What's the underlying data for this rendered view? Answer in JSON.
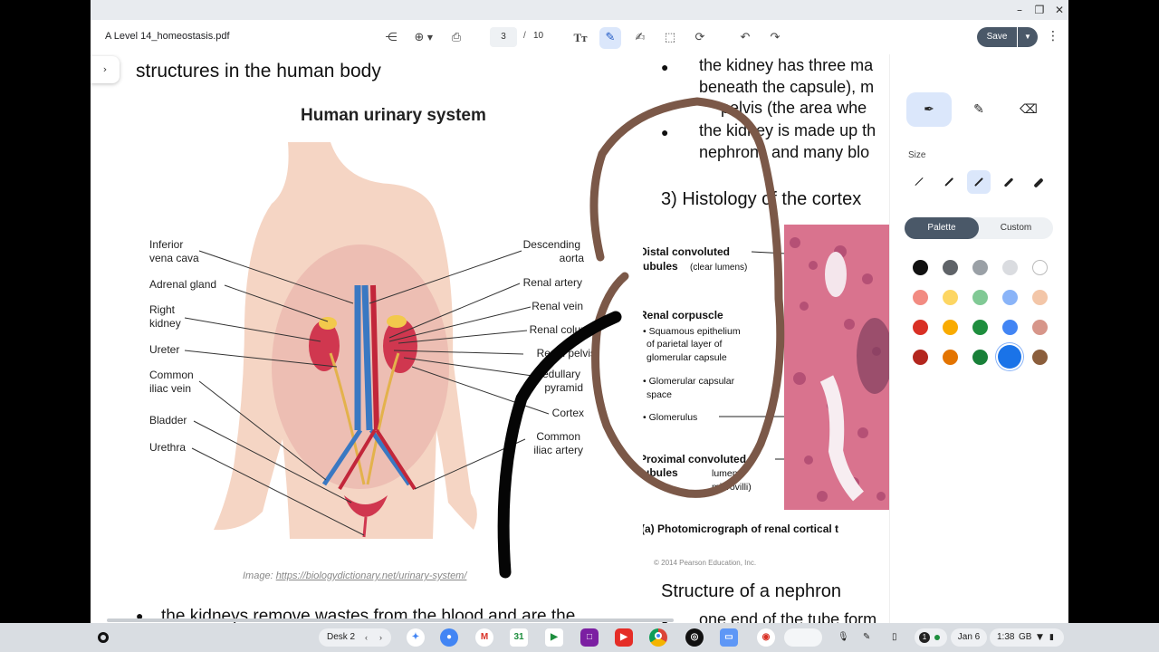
{
  "window": {
    "doc_title": "A Level 14_homeostasis.pdf",
    "current_page": "3",
    "page_separator": "/",
    "total_pages": "10",
    "save_label": "Save"
  },
  "document": {
    "left_heading": "structures in the human body",
    "diagram_title": "Human urinary system",
    "left_labels": [
      "Inferior",
      "vena cava",
      "Adrenal gland",
      "Right",
      "kidney",
      "Ureter",
      "Common",
      "iliac vein",
      "Bladder",
      "Urethra"
    ],
    "right_labels": [
      "Descending",
      "aorta",
      "Renal artery",
      "Renal vein",
      "Renal column",
      "Renal pelvis",
      "Medullary",
      "pyramid",
      "Cortex",
      "Common",
      "iliac artery"
    ],
    "image_credit_prefix": "Image: ",
    "image_credit_link": "https://biologydictionary.net/urinary-system/",
    "left_bullet": "the kidneys remove wastes from the blood and are the",
    "right_lines": [
      "the kidney has three ma",
      "beneath the capsule), m",
      "pelvis (the area whe",
      "the kidney is made up th",
      "nephrons and many blo"
    ],
    "histology_title": "3) Histology of the cortex",
    "histology_labels": {
      "dct": "Distal convoluted",
      "dct2": "tubules",
      "dct3": "(clear lumens)",
      "rc": "Renal corpuscle",
      "sq1": "• Squamous epithelium",
      "sq2": "of parietal layer of",
      "sq3": "glomerular capsule",
      "gcs1": "• Glomerular capsular",
      "gcs2": "space",
      "glom": "• Glomerulus",
      "pct1": "Proximal convoluted",
      "pct2": "tubules",
      "pct3": "lumens",
      "pct4": "microvilli)"
    },
    "photo_caption": "(a)  Photomicrograph of renal cortical t",
    "copyright": "© 2014 Pearson Education, Inc.",
    "nephron_title": "Structure of a nephron",
    "right_bottom_bullet": "one end of the tube form"
  },
  "pen_panel": {
    "tools": [
      "pen-icon",
      "highlighter-icon",
      "eraser-icon"
    ],
    "size_label": "Size",
    "palette_label": "Palette",
    "custom_label": "Custom",
    "colors": [
      [
        "#111111",
        "#5f6368",
        "#9aa0a6",
        "#dadce0",
        "#ffffff"
      ],
      [
        "#f28b82",
        "#fdd663",
        "#81c995",
        "#8ab4f8",
        "#f3c6a8"
      ],
      [
        "#d93025",
        "#f9ab00",
        "#1e8e3e",
        "#4285f4",
        "#d7968a"
      ],
      [
        "#b3261e",
        "#e37400",
        "#188038",
        "#1a73e8",
        "#8b5e3c"
      ]
    ],
    "selected_color": "#1a73e8"
  },
  "shelf": {
    "desk_label": "Desk 2",
    "date": "Jan 6",
    "time": "1:38",
    "storage": "GB",
    "notification_count": "1"
  }
}
